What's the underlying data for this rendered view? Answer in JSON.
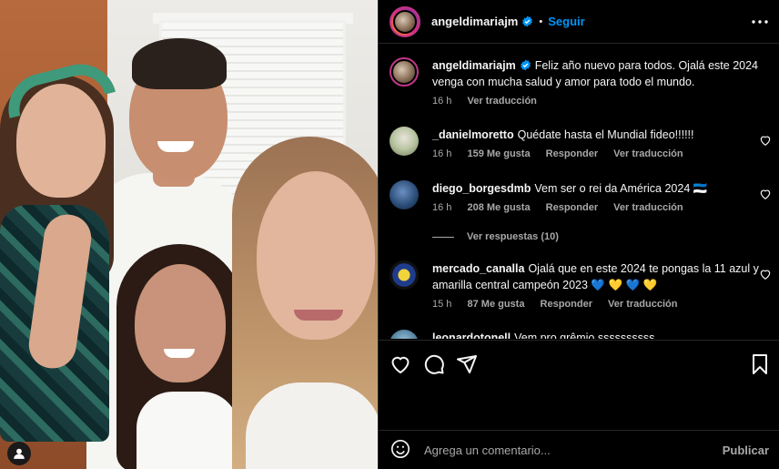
{
  "post": {
    "username": "angeldimariajm",
    "separator": "•",
    "follow_label": "Seguir",
    "more_icon": "more-horizontal-icon",
    "verified_icon": "verified-badge-icon"
  },
  "caption": {
    "username": "angeldimariajm",
    "text": "Feliz año nuevo para todos. Ojalá este 2024 venga con mucha salud y amor para todo el mundo.",
    "time": "16 h",
    "translate": "Ver traducción"
  },
  "comments": [
    {
      "username": "_danielmoretto",
      "text": "Quédate hasta el Mundial fideo!!!!!!",
      "time": "16 h",
      "likes": "159 Me gusta",
      "reply": "Responder",
      "translate": "Ver traducción"
    },
    {
      "username": "diego_borgesdmb",
      "text": "Vem ser o rei da América 2024 🇪🇪",
      "time": "16 h",
      "likes": "208 Me gusta",
      "reply": "Responder",
      "translate": "Ver traducción"
    },
    {
      "username": "mercado_canalla",
      "text": "Ojalá que en este 2024 te pongas la 11 azul y amarilla central campeón 2023 💙 💛 💙 💛",
      "time": "15 h",
      "likes": "87 Me gusta",
      "reply": "Responder",
      "translate": "Ver traducción"
    },
    {
      "username": "leonardotonell",
      "text": "Vem pro grêmio ssssssssss"
    }
  ],
  "view_replies": "Ver respuestas (10)",
  "actions": {
    "like_icon": "heart-icon",
    "comment_icon": "comment-icon",
    "share_icon": "share-icon",
    "save_icon": "bookmark-icon"
  },
  "add_comment": {
    "placeholder": "Agrega un comentario...",
    "post_label": "Publicar",
    "emoji_icon": "emoji-icon"
  },
  "colors": {
    "background": "#000000",
    "accent": "#0095f6",
    "muted": "#a8a8a8",
    "divider": "#262626"
  }
}
